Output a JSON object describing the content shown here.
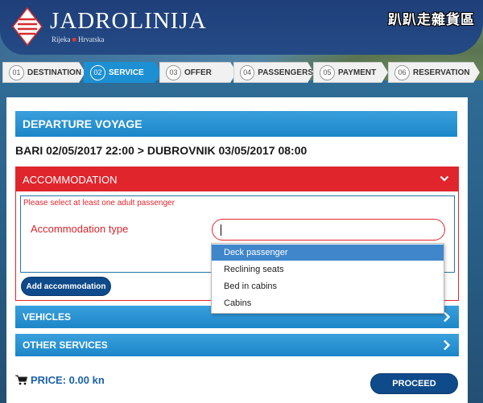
{
  "header": {
    "brand": "JADROLINIJA",
    "subtitle_left": "Rijeka",
    "subtitle_right": "Hrvatska",
    "watermark": "趴趴走雜貨區",
    "colors": {
      "navy": "#1f3f7a",
      "accent_red": "#e23a3a"
    }
  },
  "steps": [
    {
      "num": "01",
      "label": "DESTINATION",
      "active": false
    },
    {
      "num": "02",
      "label": "SERVICE",
      "active": true
    },
    {
      "num": "03",
      "label": "OFFER",
      "active": false
    },
    {
      "num": "04",
      "label": "PASSENGERS",
      "active": false
    },
    {
      "num": "05",
      "label": "PAYMENT",
      "active": false
    },
    {
      "num": "06",
      "label": "RESERVATION",
      "active": false
    }
  ],
  "main": {
    "section_title": "DEPARTURE VOYAGE",
    "route": "BARI 02/05/2017 22:00 > DUBROVNIK 03/05/2017 08:00",
    "accommodation": {
      "title": "ACCOMMODATION",
      "icon": "chevron-down-icon",
      "warning": "Please select at least one adult passenger",
      "type_label": "Accommodation type",
      "type_value": "",
      "add_button": "Add accommodation",
      "options": [
        "Deck passenger",
        "Reclining seats",
        "Bed in cabins",
        "Cabins"
      ],
      "selected_option": "Deck passenger"
    },
    "vehicles": {
      "title": "VEHICLES",
      "icon": "chevron-right-icon"
    },
    "other_services": {
      "title": "OTHER SERVICES",
      "icon": "chevron-right-icon"
    },
    "price": {
      "label": "PRICE: 0.00 kn",
      "icon": "cart-icon"
    },
    "proceed_button": "PROCEED"
  },
  "colors": {
    "step_active": "#1d8fd3",
    "section_blue": "#1b86c8",
    "error_red": "#e0252c",
    "button_navy": "#0f4a8a",
    "dropdown_highlight": "#3f86cb"
  }
}
